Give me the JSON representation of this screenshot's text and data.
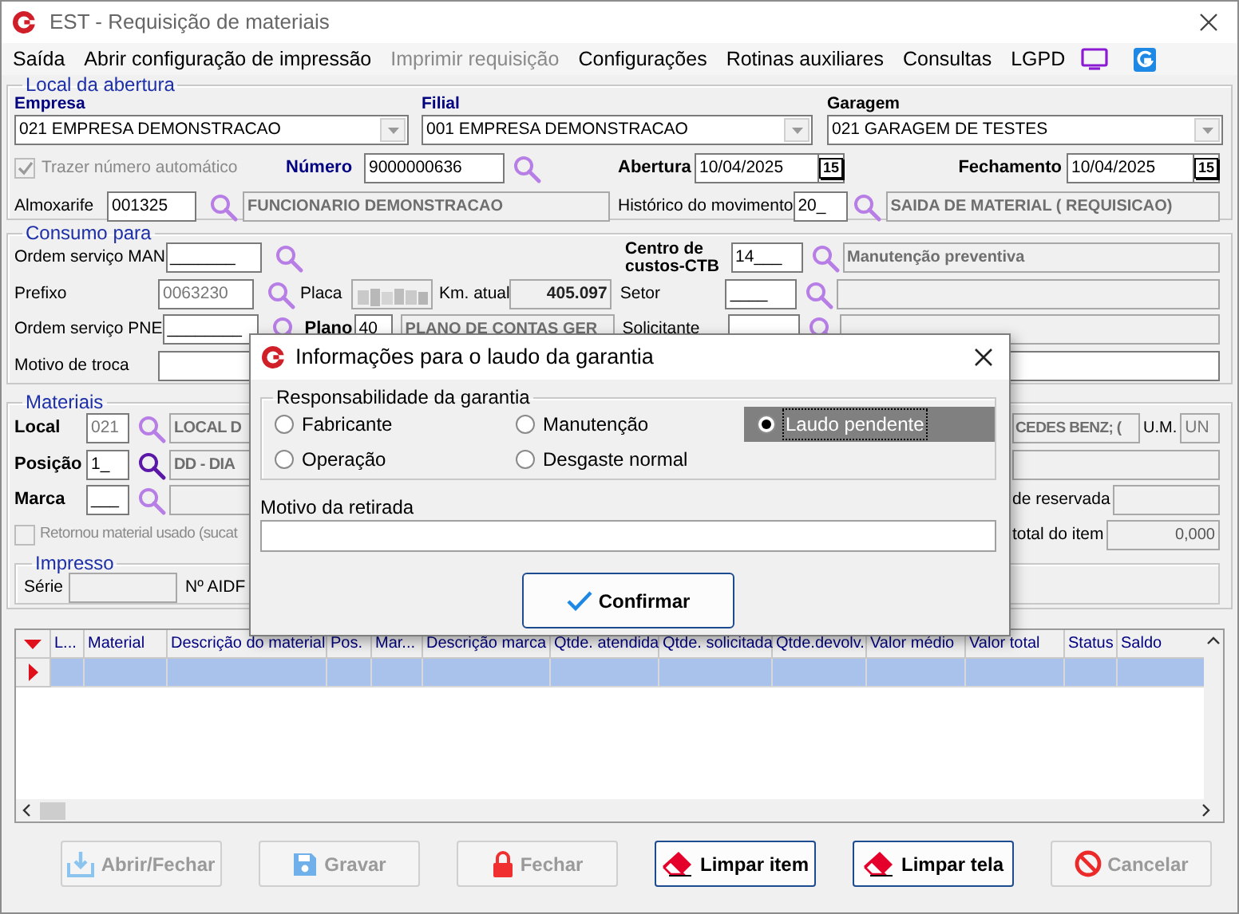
{
  "window": {
    "title": "EST - Requisição de materiais"
  },
  "menu": [
    {
      "label": "Saída",
      "disabled": false
    },
    {
      "label": "Abrir configuração de impressão",
      "disabled": false
    },
    {
      "label": "Imprimir requisição",
      "disabled": true
    },
    {
      "label": "Configurações",
      "disabled": false
    },
    {
      "label": "Rotinas auxiliares",
      "disabled": false
    },
    {
      "label": "Consultas",
      "disabled": false
    },
    {
      "label": "LGPD",
      "disabled": false
    }
  ],
  "local_abertura": {
    "legend": "Local da abertura",
    "empresa": {
      "label": "Empresa",
      "value": "021 EMPRESA DEMONSTRACAO"
    },
    "filial": {
      "label": "Filial",
      "value": "001 EMPRESA DEMONSTRACAO"
    },
    "garagem": {
      "label": "Garagem",
      "value": "021 GARAGEM DE TESTES"
    },
    "auto_number": {
      "label": "Trazer número automático",
      "checked": true,
      "disabled": true
    },
    "numero": {
      "label": "Número",
      "value": "9000000636"
    },
    "abertura": {
      "label": "Abertura",
      "value": "10/04/2025",
      "calendar": "15"
    },
    "fechamento": {
      "label": "Fechamento",
      "value": "10/04/2025",
      "calendar": "15"
    },
    "almoxarife": {
      "label": "Almoxarife",
      "code": "001325",
      "name": "FUNCIONARIO DEMONSTRACAO"
    },
    "historico": {
      "label": "Histórico do movimento",
      "code": "20_",
      "name": "SAIDA DE MATERIAL ( REQUISICAO)"
    }
  },
  "consumo": {
    "legend": "Consumo para",
    "os_man": {
      "label": "Ordem serviço MAN",
      "value": "_______"
    },
    "prefixo": {
      "label": "Prefixo",
      "value": "0063230"
    },
    "placa": {
      "label": "Placa"
    },
    "km": {
      "label": "Km. atual",
      "value": "405.097"
    },
    "os_pne": {
      "label": "Ordem serviço PNE",
      "value": "________"
    },
    "plano": {
      "label": "Plano",
      "code": "40",
      "name": "PLANO DE CONTAS GER"
    },
    "motivo_troca": {
      "label": "Motivo de troca"
    },
    "centro": {
      "label": "Centro de custos-CTB",
      "code": "14___",
      "name": "Manutenção preventiva"
    },
    "setor": {
      "label": "Setor",
      "code": "____"
    },
    "solicitante": {
      "label": "Solicitante"
    }
  },
  "materiais": {
    "legend": "Materiais",
    "local": {
      "label": "Local",
      "code": "021",
      "name": "LOCAL D"
    },
    "posicao": {
      "label": "Posição",
      "code": "1_",
      "name": "DD - DIA"
    },
    "marca": {
      "label": "Marca",
      "code": "___"
    },
    "retornou": {
      "label": "Retornou material usado (sucat",
      "checked": false,
      "disabled": true
    },
    "descricao": {
      "value": "CEDES BENZ; ("
    },
    "um": {
      "label": "U.M.",
      "value": "UN"
    },
    "reservada": {
      "label": "de reservada"
    },
    "total_item": {
      "label": "total do item",
      "value": "0,000"
    },
    "impresso": {
      "legend": "Impresso",
      "serie": {
        "label": "Série"
      },
      "aidf": {
        "label": "Nº AIDF"
      }
    }
  },
  "grid": {
    "columns": [
      "L...",
      "Material",
      "Descrição do material",
      "Pos.",
      "Mar...",
      "Descrição marca",
      "Qtde. atendida",
      "Qtde. solicitada",
      "Qtde.devolv.",
      "Valor médio",
      "Valor total",
      "Status",
      "Saldo"
    ],
    "rows": [
      {
        "selected": true
      }
    ]
  },
  "buttons": [
    {
      "label": "Abrir/Fechar",
      "kind": "download",
      "disabled": true
    },
    {
      "label": "Gravar",
      "kind": "save",
      "disabled": true
    },
    {
      "label": "Fechar",
      "kind": "lock",
      "disabled": true
    },
    {
      "label": "Limpar item",
      "kind": "eraser",
      "disabled": false
    },
    {
      "label": "Limpar tela",
      "kind": "eraser",
      "disabled": false
    },
    {
      "label": "Cancelar",
      "kind": "cancel",
      "disabled": true
    }
  ],
  "dialog": {
    "title": "Informações para o laudo da garantia",
    "legend": "Responsabilidade da garantia",
    "options": [
      {
        "label": "Fabricante",
        "selected": false
      },
      {
        "label": "Manutenção",
        "selected": false
      },
      {
        "label": "Laudo pendente",
        "selected": true
      },
      {
        "label": "Operação",
        "selected": false
      },
      {
        "label": "Desgaste normal",
        "selected": false
      }
    ],
    "motivo": {
      "label": "Motivo da retirada"
    },
    "confirm": "Confirmar"
  }
}
